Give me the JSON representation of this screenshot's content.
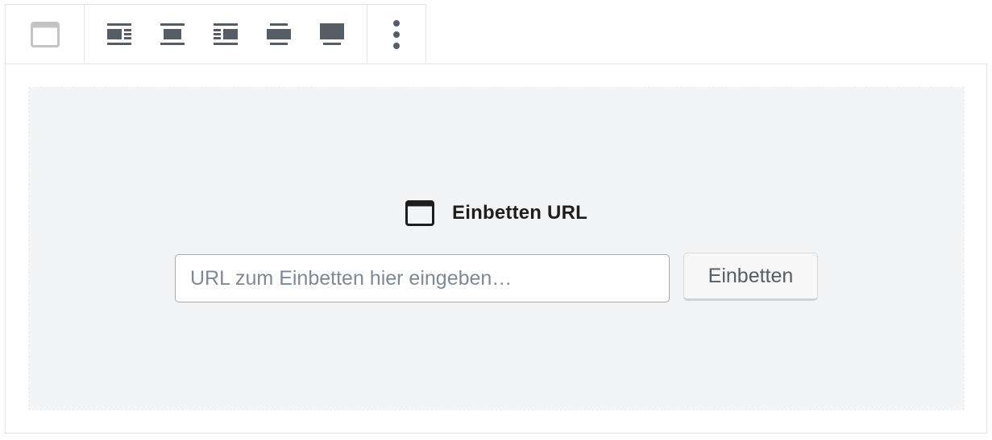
{
  "toolbar": {
    "block_type_icon": "embed-icon",
    "alignment_icons": [
      "align-left-icon",
      "align-center-icon",
      "align-right-icon",
      "align-wide-icon",
      "align-full-icon"
    ],
    "more_icon": "more-vertical-icon"
  },
  "placeholder": {
    "icon": "embed-icon",
    "label": "Einbetten URL",
    "input_placeholder": "URL zum Einbetten hier eingeben…",
    "input_value": "",
    "button_label": "Einbetten"
  },
  "colors": {
    "icon_gray": "#555d66",
    "icon_light": "#c3c4c7",
    "placeholder_bg": "#f3f4f5",
    "border": "#e2e4e7"
  }
}
